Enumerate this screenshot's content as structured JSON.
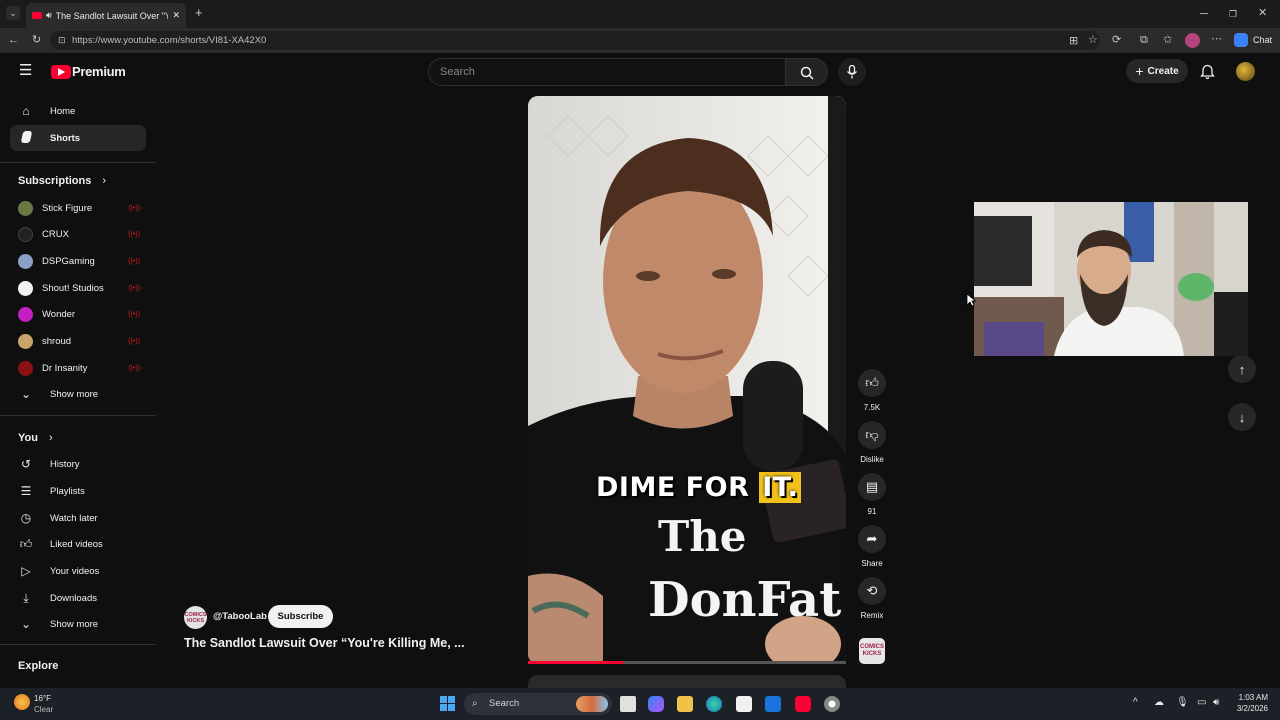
{
  "browser": {
    "tab_title": "The Sandlot Lawsuit Over \"Yo",
    "url": "https://www.youtube.com/shorts/VI81-XA42X0",
    "chat_label": "Chat"
  },
  "header": {
    "logo_text": "Premium",
    "search_placeholder": "Search",
    "create_label": "Create"
  },
  "sidebar": {
    "main": [
      {
        "label": "Home",
        "icon": "home-icon"
      },
      {
        "label": "Shorts",
        "icon": "shorts-icon",
        "active": true
      }
    ],
    "subscriptions_title": "Subscriptions",
    "subscriptions": [
      {
        "label": "Stick Figure",
        "color": "#6b7a45"
      },
      {
        "label": "CRUX",
        "color": "#222222"
      },
      {
        "label": "DSPGaming",
        "color": "#8aa0c8"
      },
      {
        "label": "Shout! Studios",
        "color": "#f1f1f1"
      },
      {
        "label": "Wonder",
        "color": "#c31fc3"
      },
      {
        "label": "shroud",
        "color": "#c9a46a"
      },
      {
        "label": "Dr Insanity",
        "color": "#8b1111"
      }
    ],
    "subs_show_more": "Show more",
    "you_title": "You",
    "you_items": [
      {
        "label": "History",
        "icon": "history-icon"
      },
      {
        "label": "Playlists",
        "icon": "playlists-icon"
      },
      {
        "label": "Watch later",
        "icon": "clock-icon"
      },
      {
        "label": "Liked videos",
        "icon": "thumbs-up-icon"
      },
      {
        "label": "Your videos",
        "icon": "video-icon"
      },
      {
        "label": "Downloads",
        "icon": "download-icon"
      }
    ],
    "you_show_more": "Show more",
    "explore_title": "Explore"
  },
  "short": {
    "caption_plain": "DIME FOR",
    "caption_highlight": "IT.",
    "progress_fraction": 0.3,
    "channel_handle": "@TabooLab",
    "channel_badge_text": "COMICS KICKS",
    "subscribe_label": "Subscribe",
    "title": "The Sandlot Lawsuit Over “You're Killing Me, ..."
  },
  "actions": {
    "like_count": "7.5K",
    "dislike_label": "Dislike",
    "comments_count": "91",
    "share_label": "Share",
    "remix_label": "Remix"
  },
  "taskbar": {
    "temperature": "16°F",
    "weather": "Clear",
    "search_label": "Search",
    "time": "1:03 AM",
    "date": "3/2/2026"
  }
}
